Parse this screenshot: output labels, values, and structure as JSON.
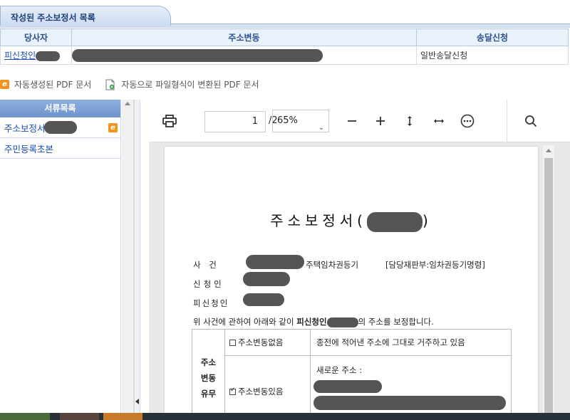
{
  "tab": {
    "title": "작성된 주소보정서 목록"
  },
  "party_table": {
    "headers": [
      "당사자",
      "주소변동",
      "송달신청"
    ],
    "row": {
      "party_prefix": "피신청인",
      "delivery": "일반송달신청"
    }
  },
  "legend": {
    "auto_pdf": "자동생성된 PDF 문서",
    "converted_pdf": "자동으로 파일형식이 변환된 PDF 문서"
  },
  "doc_list": {
    "header": "서류목록",
    "items": [
      {
        "label": "주소보정서",
        "icon": "edoc-icon"
      },
      {
        "label": "주민등록초본"
      }
    ]
  },
  "pdf_viewer": {
    "current_page": "1",
    "total_pages": "/2",
    "zoom": "65%",
    "icons": [
      "print-icon",
      "zoom-out-icon",
      "zoom-in-icon",
      "fit-height-icon",
      "fit-width-icon",
      "more-icon",
      "search-icon"
    ]
  },
  "document": {
    "title_prefix": "주소보정서(",
    "title_suffix": ")",
    "case_label": "사   건",
    "case_type": "주택임차권등기",
    "case_dept": "[담당재판부:임차권등기명령]",
    "applicant_label": "신청인",
    "respondent_label": "피신청인",
    "intro_prefix": "위 사건에 관하여 아래와 같이 ",
    "intro_bold": "피신청인",
    "intro_suffix": "의 주소를 보정합니다.",
    "section_label_1": "주소",
    "section_label_2": "변동",
    "section_label_3": "유무",
    "no_change_label": "주소변동없음",
    "no_change_desc": "종전에 적어낸 주소에 그대로 거주하고 있음",
    "change_label": "주소변동있음",
    "new_address_label": "새로운 주소 :"
  }
}
